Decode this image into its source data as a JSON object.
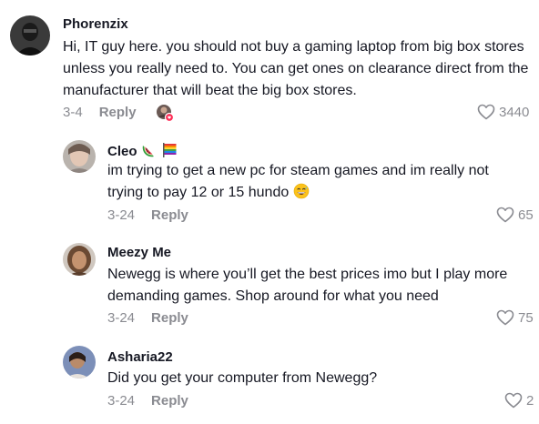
{
  "comments": [
    {
      "username": "Phorenzix",
      "lines": [
        "Hi, IT guy here. you should not buy a gaming laptop from big box stores",
        "unless you really need to. You can get ones on clearance direct from the",
        "manufacturer that will beat the big box stores."
      ],
      "date": "3-4",
      "reply_label": "Reply",
      "likes": "3440"
    },
    {
      "username": "Cleo",
      "lines": [
        "im trying to get a new pc for steam games and im really not",
        "trying to pay 12 or 15 hundo"
      ],
      "date": "3-24",
      "reply_label": "Reply",
      "likes": "65"
    },
    {
      "username": "Meezy Me",
      "lines": [
        "Newegg is where you’ll get the best prices imo but I play more",
        "demanding games. Shop around for what you need"
      ],
      "date": "3-24",
      "reply_label": "Reply",
      "likes": "75"
    },
    {
      "username": "Asharia22",
      "lines": [
        "Did you get your computer from Newegg?"
      ],
      "date": "3-24",
      "reply_label": "Reply",
      "likes": "2"
    }
  ],
  "icons": {
    "like": "heart-outline-icon",
    "creator_liked": "creator-liked-heart-icon",
    "watermelon": "watermelon-emoji",
    "pride_flag": "rainbow-flag-emoji",
    "laugh": "grinning-sweat-emoji"
  },
  "colors": {
    "text": "#161823",
    "secondary": "#8a8b91",
    "liked_badge": "#fe2c55"
  }
}
